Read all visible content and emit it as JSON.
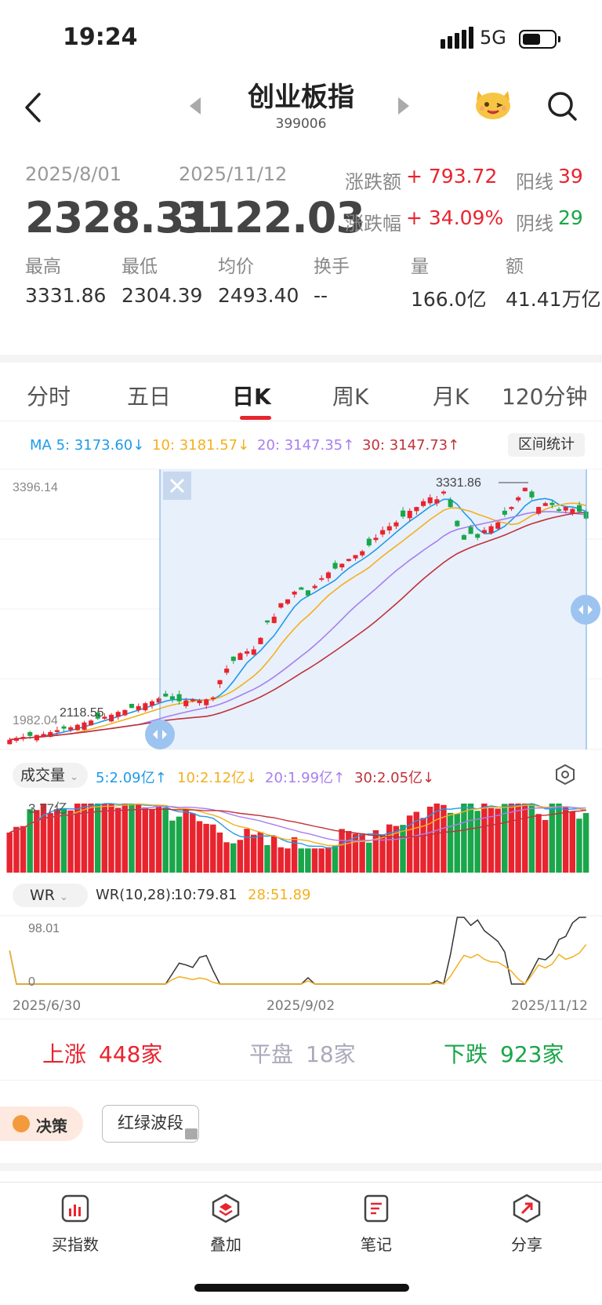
{
  "status_bar": {
    "time": "19:24",
    "network": "5G"
  },
  "header": {
    "title": "创业板指",
    "code": "399006"
  },
  "summary": {
    "start_date": "2025/8/01",
    "end_date": "2025/11/12",
    "start_price": "2328.31",
    "end_price": "3122.03",
    "change_amount_label": "涨跌额",
    "change_amount": "+ 793.72",
    "change_pct_label": "涨跌幅",
    "change_pct": "+ 34.09%",
    "up_bars_label": "阳线",
    "up_bars": "39",
    "down_bars_label": "阴线",
    "down_bars": "29",
    "stats": [
      {
        "label": "最高",
        "value": "3331.86"
      },
      {
        "label": "最低",
        "value": "2304.39"
      },
      {
        "label": "均价",
        "value": "2493.40"
      },
      {
        "label": "换手",
        "value": "--"
      },
      {
        "label": "量",
        "value": "166.0亿"
      },
      {
        "label": "额",
        "value": "41.41万亿"
      }
    ]
  },
  "tabs": [
    "分时",
    "五日",
    "日K",
    "周K",
    "月K",
    "120分钟"
  ],
  "active_tab": "日K",
  "ma_legend": {
    "ma5": "MA 5: 3173.60↓",
    "ma10": "10: 3181.57↓",
    "ma20": "20: 3147.35↑",
    "ma30": "30: 3147.73↑",
    "range_stats_button": "区间统计"
  },
  "colors": {
    "up": "#e8242f",
    "down": "#1aa64a",
    "ma5": "#1e9be9",
    "ma10": "#f2b01e",
    "ma20": "#a77ff0",
    "ma30": "#c0323a",
    "selection": "#e8f0fb"
  },
  "chart_data": [
    {
      "type": "candlestick",
      "y_axis_labels": [
        "3396.14",
        "1982.04"
      ],
      "annotations": {
        "high": "3331.86",
        "low": "2118.55"
      },
      "series_close_approx": [
        1990,
        2000,
        2005,
        2010,
        2015,
        2020,
        2030,
        2040,
        2048,
        2055,
        2068,
        2080,
        2090,
        2100,
        2110,
        2120,
        2135,
        2145,
        2155,
        2165,
        2180,
        2190,
        2205,
        2215,
        2200,
        2190,
        2195,
        2200,
        2195,
        2200,
        2210,
        2300,
        2360,
        2400,
        2440,
        2450,
        2460,
        2520,
        2600,
        2630,
        2700,
        2720,
        2760,
        2770,
        2740,
        2790,
        2830,
        2860,
        2880,
        2905,
        2930,
        2950,
        2970,
        3000,
        3040,
        3080,
        3100,
        3120,
        3150,
        3180,
        3200,
        3230,
        3250,
        3240,
        3280,
        3200,
        3100,
        3030,
        3060,
        3040,
        3080,
        3100,
        3120,
        3160,
        3200,
        3250,
        3300,
        3250,
        3200,
        3220,
        3210,
        3180,
        3200,
        3190,
        3175,
        3140
      ]
    },
    {
      "type": "bar",
      "name": "成交量",
      "y_axis_label": "3.77亿",
      "ma_legend": [
        "5:2.09亿↑",
        "10:2.12亿↓",
        "20:1.99亿↑",
        "30:2.05亿↓"
      ]
    },
    {
      "type": "line",
      "name": "WR",
      "y_axis_labels": [
        "98.01",
        "0"
      ],
      "legend": [
        "WR(10,28):",
        "10:79.81",
        "28:51.89"
      ],
      "x_axis_labels": [
        "2025/6/30",
        "2025/9/02",
        "2025/11/12"
      ]
    }
  ],
  "volume_select": "成交量",
  "wr_select": "WR",
  "breadth": {
    "up_label": "上涨",
    "up_value": "448家",
    "flat_label": "平盘",
    "flat_value": "18家",
    "down_label": "下跌",
    "down_value": "923家"
  },
  "tools": {
    "decision": "决策",
    "red_green_wave": "红绿波段"
  },
  "bottom_nav": [
    "买指数",
    "叠加",
    "笔记",
    "分享"
  ]
}
